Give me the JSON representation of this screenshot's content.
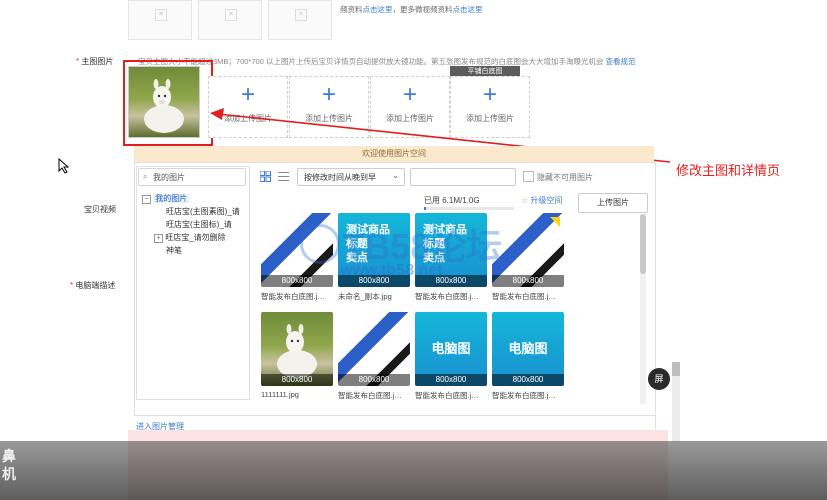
{
  "top_row": {
    "note_prefix": "频资料",
    "note_link1": "点击这里",
    "note_mid": "，更多微视频资料",
    "note_link2": "点击这里"
  },
  "main_image": {
    "label": "主图图片",
    "hint": "宝贝主图大小不能超过3MB；700*700 以上图片上传后宝贝详情页自动提供放大镜功能。第五张图发布规范的白底图会大大增加手淘曝光机会",
    "hint_link": "查看规范",
    "slot_label": "添加上传图片",
    "flat_label": "平铺白底图"
  },
  "annotation": {
    "text": "修改主图和详情页",
    "color": "#e02020"
  },
  "side_labels": {
    "video": "宝贝视频",
    "desc": "电脑端描述",
    "left_glyph_1": "鼻",
    "left_glyph_2": "机"
  },
  "picker": {
    "welcome": "欢迎使用图片空间",
    "search_placeholder": "我的图片",
    "sort_label": "按修改时间从晚到早",
    "hide_unavailable": "隐藏不可用图片",
    "usage": "已用 6.1M/1.0G",
    "upgrade": "升级空间",
    "upload_button": "上传图片",
    "manage_link": "进入图片管理",
    "tree": [
      {
        "label": "我的图片",
        "level": 0,
        "expanded": true
      },
      {
        "label": "旺店宝(主图素图)_请",
        "level": 1
      },
      {
        "label": "旺店宝(主图标)_请",
        "level": 1
      },
      {
        "label": "旺店宝_请勿删除",
        "level": 1,
        "expandable": true
      },
      {
        "label": "神笔",
        "level": 1
      }
    ],
    "images": [
      {
        "name": "智能发布白底图.j…",
        "size": "800x800",
        "style": "stripe"
      },
      {
        "name": "未命名_副本.jpg",
        "size": "800x800",
        "style": "cyan-text"
      },
      {
        "name": "智能发布白底图.j…",
        "size": "800x800",
        "style": "cyan-text"
      },
      {
        "name": "智能发布白底图.j…",
        "size": "800x800",
        "style": "stripe-yellow"
      },
      {
        "name": "1111111.jpg",
        "size": "800x800",
        "style": "alpaca"
      },
      {
        "name": "智能发布白底图.j…",
        "size": "800x800",
        "style": "stripe"
      },
      {
        "name": "智能发布白底图.j…",
        "size": "800x800",
        "style": "cyan-pc"
      },
      {
        "name": "智能发布白底图.j…",
        "size": "800x800",
        "style": "cyan-pc"
      }
    ],
    "tile_text_1": "测试商品",
    "tile_text_2": "标题",
    "tile_text_3": "卖点",
    "tile_text_pc": "电脑图"
  },
  "watermark": {
    "text": "TB58论坛",
    "url": "www.tb58.net"
  },
  "side_button": "屏"
}
